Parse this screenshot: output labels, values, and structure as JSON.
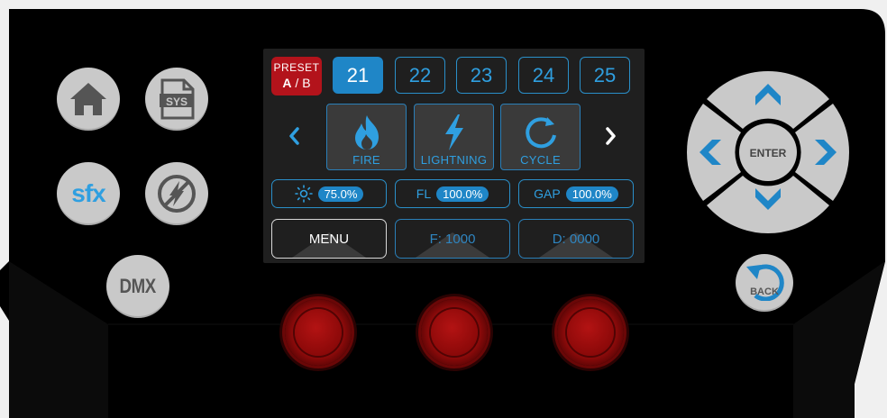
{
  "preset": {
    "line1": "PRESET",
    "a": "A",
    "sep": " / ",
    "b": "B"
  },
  "presets": [
    "21",
    "22",
    "23",
    "24",
    "25"
  ],
  "effects": [
    "FIRE",
    "LIGHTNING",
    "CYCLE"
  ],
  "params": {
    "brightness_value": "75.0%",
    "fl_label": "FL",
    "fl_value": "100.0%",
    "gap_label": "GAP",
    "gap_value": "100.0%"
  },
  "softkeys": {
    "menu": "MENU",
    "f": "F: 1000",
    "d": "D: 0000"
  },
  "side_buttons": {
    "sys": "SYS",
    "sfx": "sfx",
    "dmx": "DMX",
    "enter": "ENTER",
    "back": "BACK"
  },
  "icons": [
    "home-icon",
    "sys-file-icon",
    "sfx-icon",
    "no-flash-icon",
    "flame-icon",
    "lightning-icon",
    "cycle-icon",
    "brightness-icon",
    "chevron-left-icon",
    "chevron-right-icon",
    "nav-up-icon",
    "nav-down-icon",
    "nav-left-icon",
    "nav-right-icon",
    "back-icon"
  ],
  "colors": {
    "accent": "#2f9fe0",
    "preset_red": "#b3131b",
    "button_gray": "#c9c9c9",
    "knob_red": "#8a0a0a",
    "panel": "#000000"
  }
}
